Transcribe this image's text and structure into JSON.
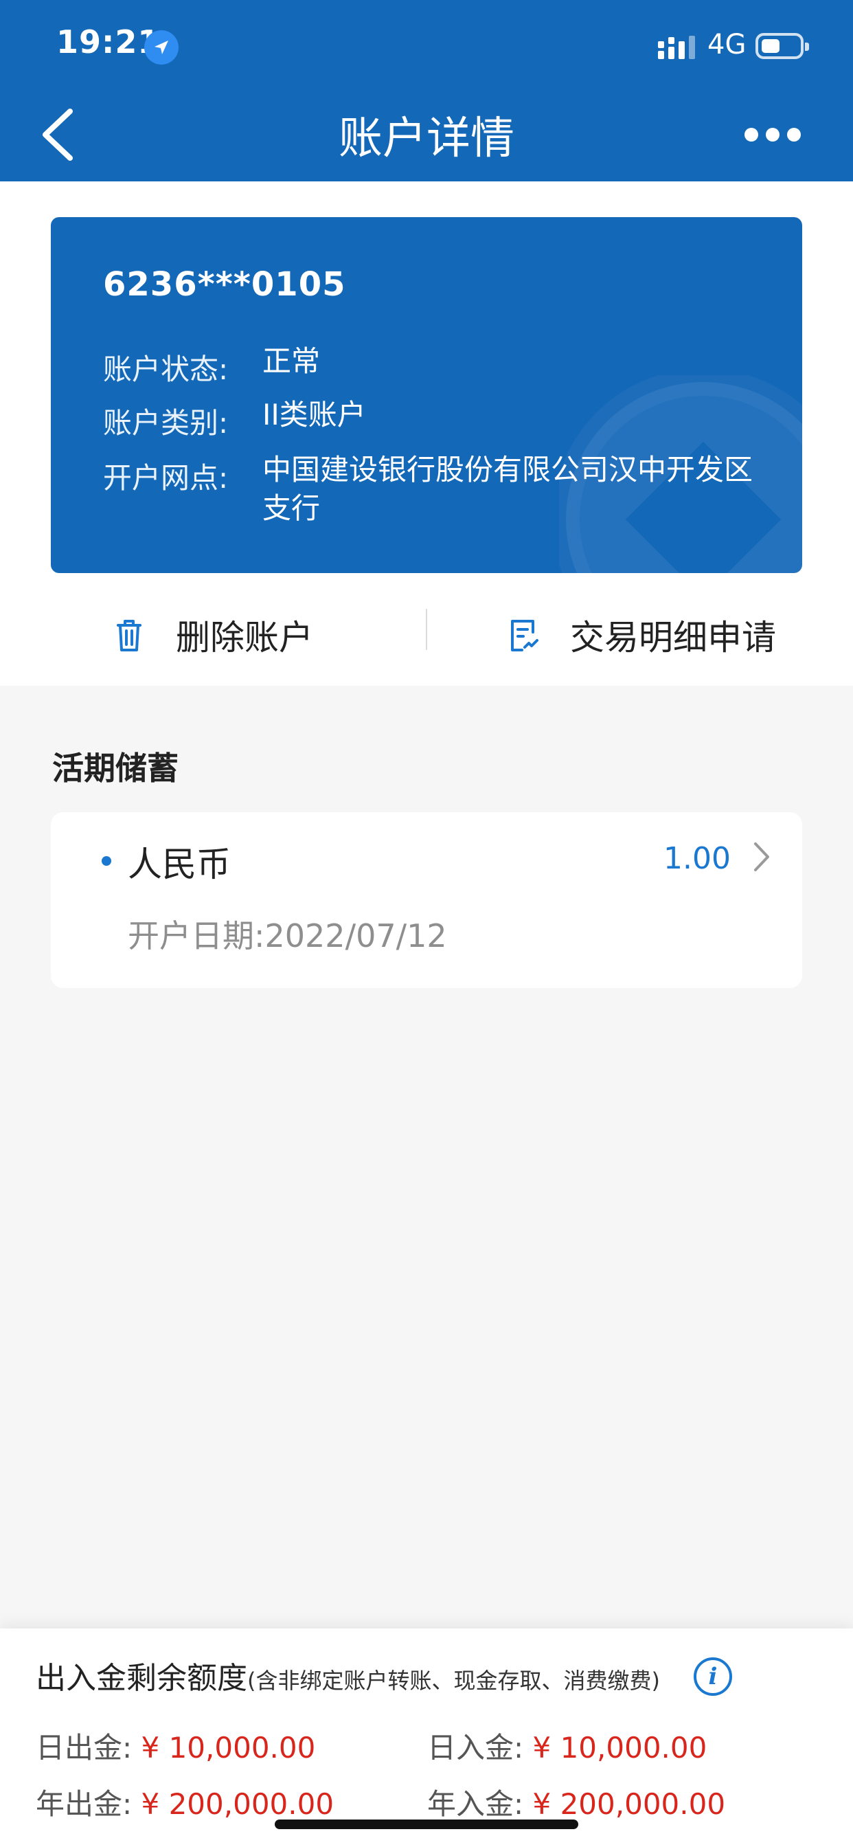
{
  "status_bar": {
    "time": "19:21",
    "network": "4G"
  },
  "header": {
    "title": "账户详情"
  },
  "card": {
    "account_number": "6236***0105",
    "rows": [
      {
        "label": "账户状态:",
        "value": "正常"
      },
      {
        "label": "账户类别:",
        "value": "II类账户"
      },
      {
        "label": "开户网点:",
        "value": "中国建设银行股份有限公司汉中开发区支行"
      }
    ]
  },
  "actions": {
    "delete_label": "删除账户",
    "statement_label": "交易明细申请"
  },
  "savings": {
    "section_title": "活期储蓄",
    "currency": "人民币",
    "balance": "1.00",
    "open_date_label": "开户日期:",
    "open_date": "2022/07/12"
  },
  "quota": {
    "title": "出入金剩余额度",
    "note": "(含非绑定账户转账、现金存取、消费缴费)",
    "items": [
      {
        "label": "日出金:",
        "amount": "¥ 10,000.00"
      },
      {
        "label": "日入金:",
        "amount": "¥ 10,000.00"
      },
      {
        "label": "年出金:",
        "amount": "¥ 200,000.00"
      },
      {
        "label": "年入金:",
        "amount": "¥ 200,000.00"
      }
    ]
  },
  "colors": {
    "brand_blue": "#1468b8",
    "accent_blue": "#1a78d0",
    "amount_red": "#d9261c"
  },
  "icons": [
    "location-arrow-icon",
    "signal-icon",
    "battery-icon",
    "back-arrow-icon",
    "more-icon",
    "trash-icon",
    "document-icon",
    "chevron-right-icon",
    "info-icon",
    "bank-logo-icon"
  ]
}
